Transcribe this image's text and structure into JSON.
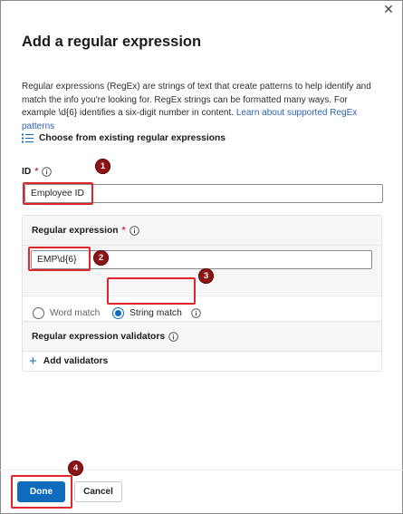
{
  "dialog": {
    "title": "Add a regular expression",
    "close_glyph": "✕",
    "description": "Regular expressions (RegEx) are strings of text that create patterns to help identify and match the info you're looking for. RegEx strings can be formatted many ways. For example \\d{6} identifies a six-digit number in content.",
    "learn_link": "Learn about supported RegEx patterns",
    "choose_existing": "Choose from existing regular expressions"
  },
  "id_field": {
    "label": "ID",
    "required_mark": "*",
    "value": "Employee ID"
  },
  "regex_section": {
    "title": "Regular expression",
    "required_mark": "*",
    "value": "EMP\\d{6}",
    "options": [
      {
        "label": "Word match",
        "selected": false
      },
      {
        "label": "String match",
        "selected": true
      }
    ]
  },
  "validators_section": {
    "title": "Regular expression validators",
    "add_label": "Add validators"
  },
  "footer": {
    "done_label": "Done",
    "cancel_label": "Cancel"
  },
  "annotations": {
    "badges": [
      "1",
      "2",
      "3",
      "4"
    ]
  },
  "colors": {
    "accent": "#0f6cbd",
    "highlight": "#e0262b",
    "badge": "#8c1515",
    "required": "#c4314b",
    "link": "#2b63b6"
  },
  "icons": {
    "close": "close-icon",
    "list": "list-icon",
    "info": "info-icon",
    "plus": "plus-icon"
  }
}
